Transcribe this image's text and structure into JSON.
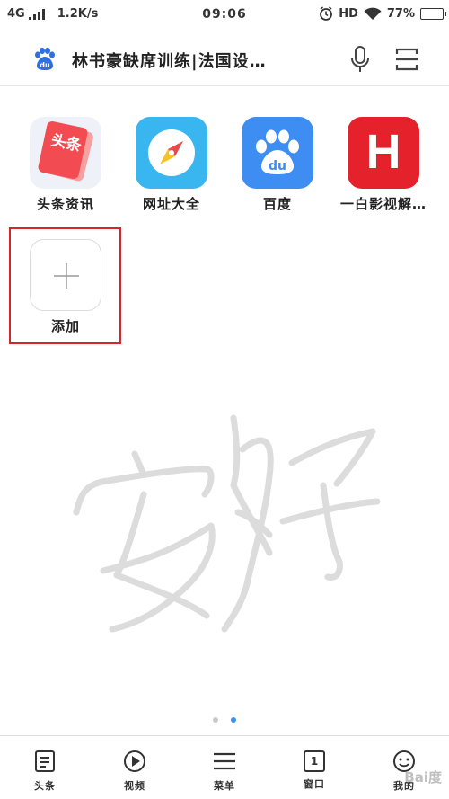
{
  "status_bar": {
    "network": "4G",
    "speed": "1.2K/s",
    "time": "09:06",
    "hd": "HD",
    "battery_text": "77%",
    "battery_level": 0.77
  },
  "search_bar": {
    "query": "林书豪缺席训练|法国设…",
    "icons": [
      "baidu-logo-icon",
      "microphone-icon",
      "scan-icon"
    ]
  },
  "apps": [
    {
      "label": "头条资讯",
      "icon": "toutiao-icon",
      "icon_text": "头条"
    },
    {
      "label": "网址大全",
      "icon": "compass-icon"
    },
    {
      "label": "百度",
      "icon": "baidu-paw-icon",
      "icon_text": "du"
    },
    {
      "label": "一白影视解…",
      "icon": "letter-h-icon",
      "icon_text": "H"
    },
    {
      "label": "添加",
      "icon": "plus-icon"
    }
  ],
  "pagination": {
    "pages": 2,
    "active": 2
  },
  "bottom_nav": [
    {
      "label": "头条",
      "icon": "news-icon"
    },
    {
      "label": "视频",
      "icon": "play-icon"
    },
    {
      "label": "菜单",
      "icon": "menu-icon"
    },
    {
      "label": "窗口",
      "icon": "window-icon",
      "icon_text": "1"
    },
    {
      "label": "我的",
      "icon": "profile-icon"
    }
  ],
  "watermark_corner": "Bai度",
  "colors": {
    "baidu_blue": "#3d8df3",
    "highlight_red": "#d6262d",
    "h_red": "#e5222b",
    "toutiao_red": "#f24b51",
    "wangzhi_blue": "#39b6f0"
  }
}
